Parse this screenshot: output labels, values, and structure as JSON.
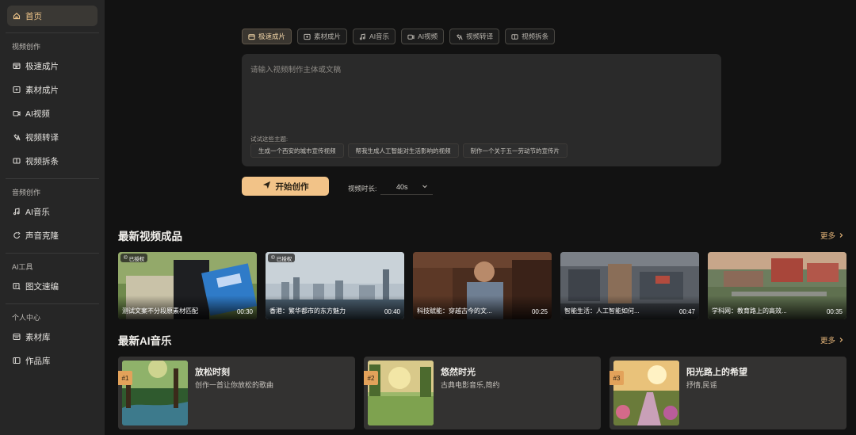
{
  "sidebar": {
    "home": "首页",
    "sections": [
      {
        "title": "视频创作",
        "items": [
          {
            "label": "极速成片",
            "icon": "fast-video-icon"
          },
          {
            "label": "素材成片",
            "icon": "material-video-icon"
          },
          {
            "label": "AI视频",
            "icon": "ai-video-icon"
          },
          {
            "label": "视频转译",
            "icon": "video-translate-icon"
          },
          {
            "label": "视频拆条",
            "icon": "video-split-icon"
          }
        ]
      },
      {
        "title": "音频创作",
        "items": [
          {
            "label": "AI音乐",
            "icon": "music-icon"
          },
          {
            "label": "声音克隆",
            "icon": "voice-clone-icon"
          }
        ]
      },
      {
        "title": "AI工具",
        "items": [
          {
            "label": "图文速编",
            "icon": "image-text-icon"
          }
        ]
      },
      {
        "title": "个人中心",
        "items": [
          {
            "label": "素材库",
            "icon": "library-icon"
          },
          {
            "label": "作品库",
            "icon": "works-icon"
          }
        ]
      }
    ]
  },
  "tabs": [
    "极速成片",
    "素材成片",
    "AI音乐",
    "AI视频",
    "视频转译",
    "视频拆条"
  ],
  "editor": {
    "placeholder": "请输入视频制作主体或文稿",
    "try_label": "试试这些主题:",
    "chips": [
      "生成一个西安的城市宣传视频",
      "帮我生成人工智能对生活影响的视频",
      "制作一个关于五一劳动节的宣传片"
    ]
  },
  "actions": {
    "start": "开始创作",
    "duration_label": "视频时长:",
    "duration_value": "40s"
  },
  "videos_section": {
    "title": "最新视频成品",
    "more": "更多",
    "items": [
      {
        "title": "测试文案不分段原素材匹配",
        "duration": "00:30",
        "badge": "已授权"
      },
      {
        "title": "香港：繁华都市的东方魅力",
        "duration": "00:40",
        "badge": "已授权"
      },
      {
        "title": "科技赋能：穿越古今的文...",
        "duration": "00:25",
        "badge": ""
      },
      {
        "title": "智能生活：人工智能如何...",
        "duration": "00:47",
        "badge": ""
      },
      {
        "title": "学科网：教育路上的高效...",
        "duration": "00:35",
        "badge": ""
      }
    ]
  },
  "music_section": {
    "title": "最新AI音乐",
    "more": "更多",
    "items": [
      {
        "rank": "#1",
        "title": "放松时刻",
        "desc": "创作一首让你放松的歌曲"
      },
      {
        "rank": "#2",
        "title": "悠然时光",
        "desc": "古典电影音乐,简约"
      },
      {
        "rank": "#3",
        "title": "阳光路上的希望",
        "desc": "抒情,民谣"
      }
    ]
  },
  "colors": {
    "accent": "#f2c388",
    "sidebar_bg": "#262626",
    "page_bg": "#121212"
  }
}
